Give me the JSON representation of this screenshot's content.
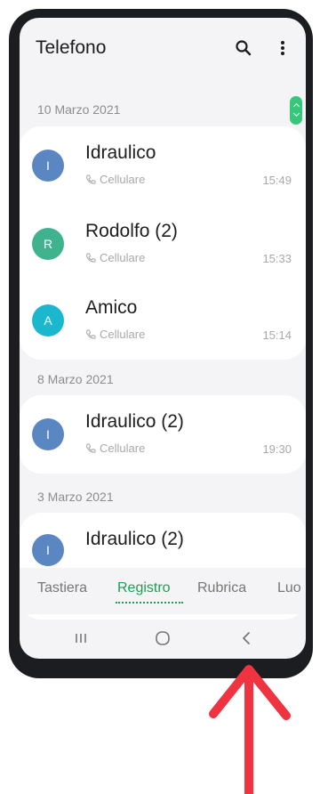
{
  "app": {
    "title": "Telefono"
  },
  "icons": {
    "search": "search-icon",
    "more": "more-vertical-icon",
    "call": "phone-call-icon",
    "scroll": "scroll-tab-icon"
  },
  "colors": {
    "accent_green": "#1f9d54",
    "avatar_blue": "#5a86c2",
    "avatar_green": "#3eb38d",
    "avatar_cyan": "#1bb7cf",
    "arrow_red": "#ef3340"
  },
  "log": {
    "groups": [
      {
        "date": "10 Marzo 2021",
        "calls": [
          {
            "initial": "I",
            "name": "Idraulico",
            "type": "Cellulare",
            "time": "15:49"
          },
          {
            "initial": "R",
            "name": "Rodolfo (2)",
            "type": "Cellulare",
            "time": "15:33"
          },
          {
            "initial": "A",
            "name": "Amico",
            "type": "Cellulare",
            "time": "15:14"
          }
        ]
      },
      {
        "date": "8 Marzo 2021",
        "calls": [
          {
            "initial": "I",
            "name": "Idraulico (2)",
            "type": "Cellulare",
            "time": "19:30"
          }
        ]
      },
      {
        "date": "3 Marzo 2021",
        "calls": [
          {
            "initial": "I",
            "name": "Idraulico (2)",
            "type": "",
            "time": ""
          }
        ]
      }
    ]
  },
  "tabs": {
    "items": [
      {
        "label": "Tastiera",
        "active": false
      },
      {
        "label": "Registro",
        "active": true
      },
      {
        "label": "Rubrica",
        "active": false
      },
      {
        "label": "Luo",
        "active": false
      }
    ]
  },
  "navbar": {
    "recents": "recents-icon",
    "home": "home-icon",
    "back": "back-icon"
  }
}
